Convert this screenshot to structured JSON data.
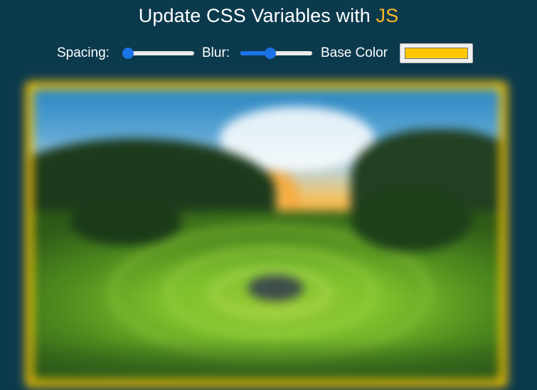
{
  "header": {
    "title_main": "Update CSS Variables with ",
    "title_highlight": "JS",
    "highlight_color": "#fdba24"
  },
  "controls": {
    "spacing": {
      "label": "Spacing:",
      "value": 0.0
    },
    "blur": {
      "label": "Blur:",
      "value": 0.4
    },
    "base_color": {
      "label": "Base Color",
      "value": "#ffc600"
    }
  },
  "image": {
    "icon": "landscape-photo",
    "frame_color": "#ffc600"
  },
  "colors": {
    "background": "#0c3a4d",
    "slider_accent": "#1a73e8"
  }
}
